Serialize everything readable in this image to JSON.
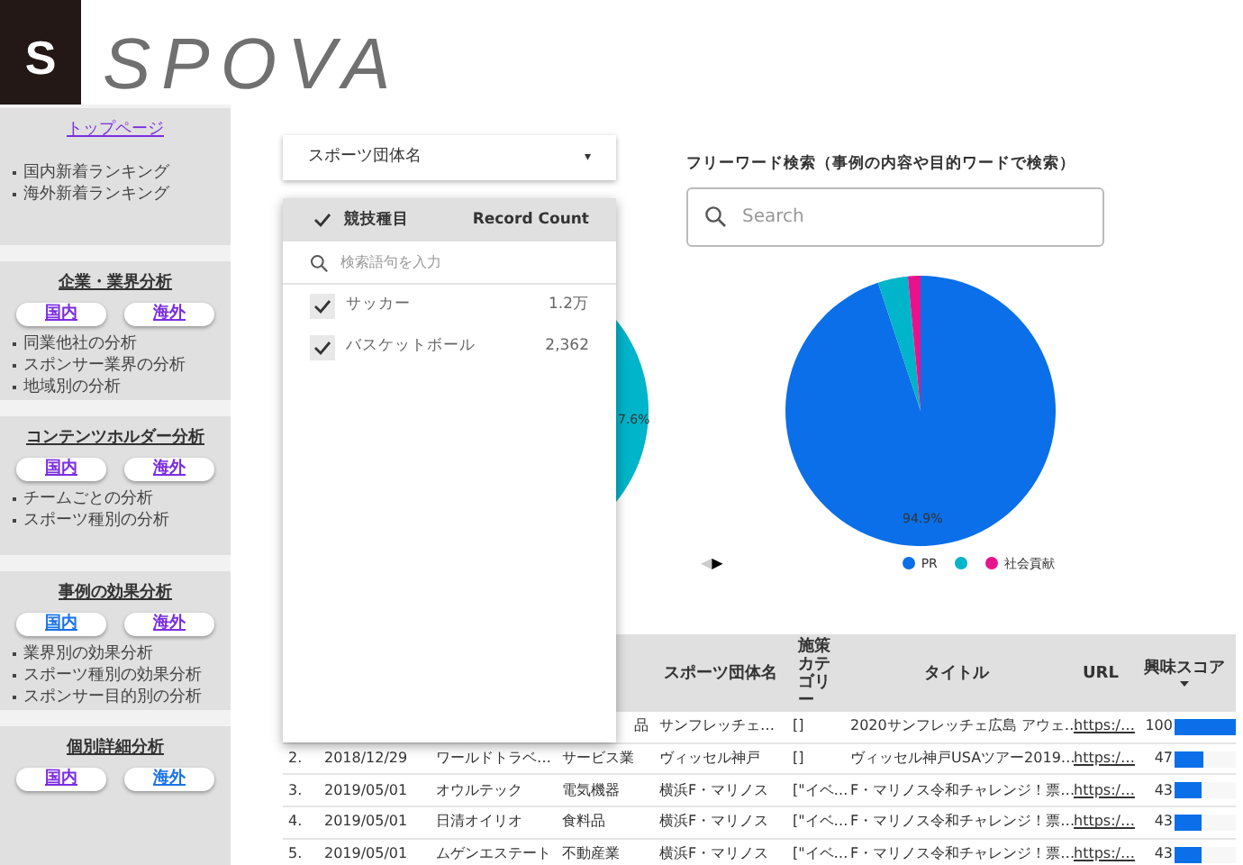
{
  "logo": {
    "mark": "S",
    "name": "SPOVA"
  },
  "sidebar": {
    "sections": [
      {
        "kind": "top",
        "link": "トップページ",
        "items": [
          "国内新着ランキング",
          "海外新着ランキング"
        ]
      },
      {
        "kind": "group",
        "title": "企業・業界分析",
        "buttons": [
          {
            "label": "国内",
            "visited": true
          },
          {
            "label": "海外",
            "visited": true
          }
        ],
        "items": [
          "同業他社の分析",
          "スポンサー業界の分析",
          "地域別の分析"
        ]
      },
      {
        "kind": "group",
        "title": "コンテンツホルダー分析",
        "buttons": [
          {
            "label": "国内",
            "visited": true
          },
          {
            "label": "海外",
            "visited": true
          }
        ],
        "items": [
          "チームごとの分析",
          "スポーツ種別の分析"
        ]
      },
      {
        "kind": "group",
        "title": "事例の効果分析",
        "buttons": [
          {
            "label": "国内",
            "visited": false
          },
          {
            "label": "海外",
            "visited": true
          }
        ],
        "items": [
          "業界別の効果分析",
          "スポーツ種別の効果分析",
          "スポンサー目的別の分析"
        ]
      },
      {
        "kind": "group",
        "title": "個別詳細分析",
        "buttons": [
          {
            "label": "国内",
            "visited": true
          },
          {
            "label": "海外",
            "visited": false
          }
        ]
      }
    ]
  },
  "filter": {
    "label": "スポーツ団体名",
    "caret": "▾"
  },
  "popup": {
    "header": {
      "label": "競技種目",
      "checked": true,
      "count_label": "Record Count"
    },
    "search": {
      "placeholder": "検索語句を入力"
    },
    "options": [
      {
        "label": "サッカー",
        "count": "1.2万",
        "checked": true
      },
      {
        "label": "バスケットボール",
        "count": "2,362",
        "checked": true
      }
    ]
  },
  "left_chart": {
    "slice_label": "7.6%"
  },
  "search": {
    "title": "フリーワード検索（事例の内容や目的ワードで検索）",
    "placeholder": "Search"
  },
  "right_chart": {
    "slice_label": "94.9%",
    "legend": [
      {
        "label": "PR",
        "color": "#0a6fe8"
      },
      {
        "color": "#00b4c9"
      },
      {
        "label": "社会貢献",
        "color": "#e8128c"
      }
    ],
    "pager": {
      "prev": "◀",
      "next": "▶"
    }
  },
  "table": {
    "columns": [
      {
        "label": "スポーツ団体名",
        "sorted": false
      },
      {
        "label": "施策カテゴリー",
        "sorted": false
      },
      {
        "label": "タイトル",
        "sorted": false
      },
      {
        "label": "URL",
        "sorted": false
      },
      {
        "label": "興味スコア",
        "sorted": true
      }
    ],
    "rows": [
      {
        "industry": "品",
        "team": "サンフレッチェ…",
        "category": "[]",
        "title": "2020サンフレッチェ広島 アウェ…",
        "url": "https:/…",
        "score": "100",
        "level": 1
      },
      {
        "number": "2.",
        "date": "2018/12/29",
        "company": "ワールドトラベ…",
        "industry": "サービス業",
        "team": "ヴィッセル神戸",
        "category": "[]",
        "title": "ヴィッセル神戸USAツアー2019…",
        "url": "https:/…",
        "score": "47",
        "level": 0.47
      },
      {
        "number": "3.",
        "date": "2019/05/01",
        "company": "オウルテック",
        "industry": "電気機器",
        "team": "横浜F・マリノス",
        "category": "[\"イベ…",
        "title": "F・マリノス令和チャレンジ！票…",
        "url": "https:/…",
        "score": "43",
        "level": 0.43
      },
      {
        "number": "4.",
        "date": "2019/05/01",
        "company": "日清オイリオ",
        "industry": "食料品",
        "team": "横浜F・マリノス",
        "category": "[\"イベ…",
        "title": "F・マリノス令和チャレンジ！票…",
        "url": "https:/…",
        "score": "43",
        "level": 0.43
      },
      {
        "number": "5.",
        "date": "2019/05/01",
        "company": "ムゲンエステート",
        "industry": "不動産業",
        "team": "横浜F・マリノス",
        "category": "[\"イベ…",
        "title": "F・マリノス令和チャレンジ！票…",
        "url": "https:/…",
        "score": "43",
        "level": 0.43
      }
    ]
  }
}
